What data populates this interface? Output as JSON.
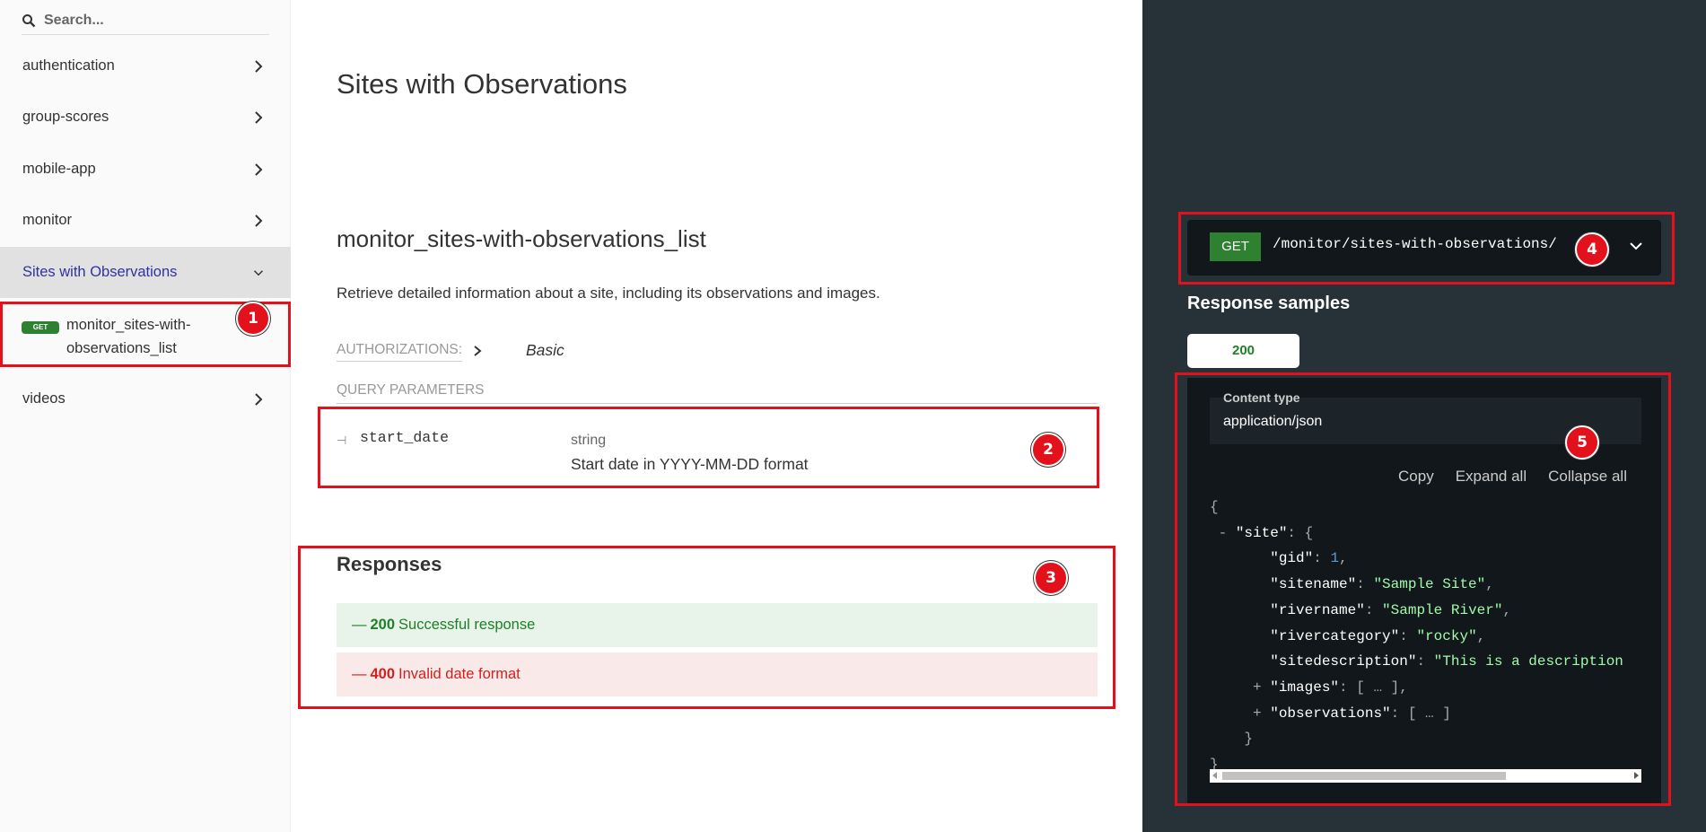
{
  "sidebar": {
    "search_placeholder": "Search...",
    "items": [
      {
        "label": "authentication"
      },
      {
        "label": "group-scores"
      },
      {
        "label": "mobile-app"
      },
      {
        "label": "monitor"
      },
      {
        "label": "Sites with Observations"
      },
      {
        "label": "videos"
      }
    ],
    "sub_item": {
      "method": "GET",
      "label": "monitor_sites-with-observations_list"
    }
  },
  "main": {
    "title": "Sites with Observations",
    "operation_title": "monitor_sites-with-observations_list",
    "description": "Retrieve detailed information about a site, including its observations and images.",
    "authorizations_label": "AUTHORIZATIONS:",
    "authorizations_value": "Basic",
    "query_params_label": "QUERY PARAMETERS",
    "param": {
      "name": "start_date",
      "type": "string",
      "description": "Start date in YYYY-MM-DD format"
    },
    "responses_title": "Responses",
    "responses": [
      {
        "dash": "—",
        "code": "200",
        "text": "Successful response",
        "color": "#1d8127"
      },
      {
        "dash": "—",
        "code": "400",
        "text": "Invalid date format",
        "color": "#d41f1c"
      }
    ]
  },
  "panel": {
    "method": "GET",
    "path": "/monitor/sites-with-observations/",
    "samples_title": "Response samples",
    "status_tab": "200",
    "content_type_label": "Content type",
    "content_type_value": "application/json",
    "tools": {
      "copy": "Copy",
      "expand": "Expand all",
      "collapse": "Collapse all"
    },
    "json_keys": {
      "site": "\"site\"",
      "gid": "\"gid\"",
      "sitename": "\"sitename\"",
      "rivername": "\"rivername\"",
      "rivercategory": "\"rivercategory\"",
      "sitedescription": "\"sitedescription\"",
      "images": "\"images\"",
      "observations": "\"observations\""
    },
    "json_values": {
      "gid": "1",
      "sitename": "\"Sample Site\"",
      "rivername": "\"Sample River\"",
      "rivercategory": "\"rocky\"",
      "sitedescription": "\"This is a description"
    }
  },
  "markers": [
    "1",
    "2",
    "3",
    "4",
    "5"
  ],
  "colors": {
    "accent": "#32329f",
    "get": "#2f8132",
    "panel_bg": "#263238",
    "annotation": "#e3111c"
  }
}
